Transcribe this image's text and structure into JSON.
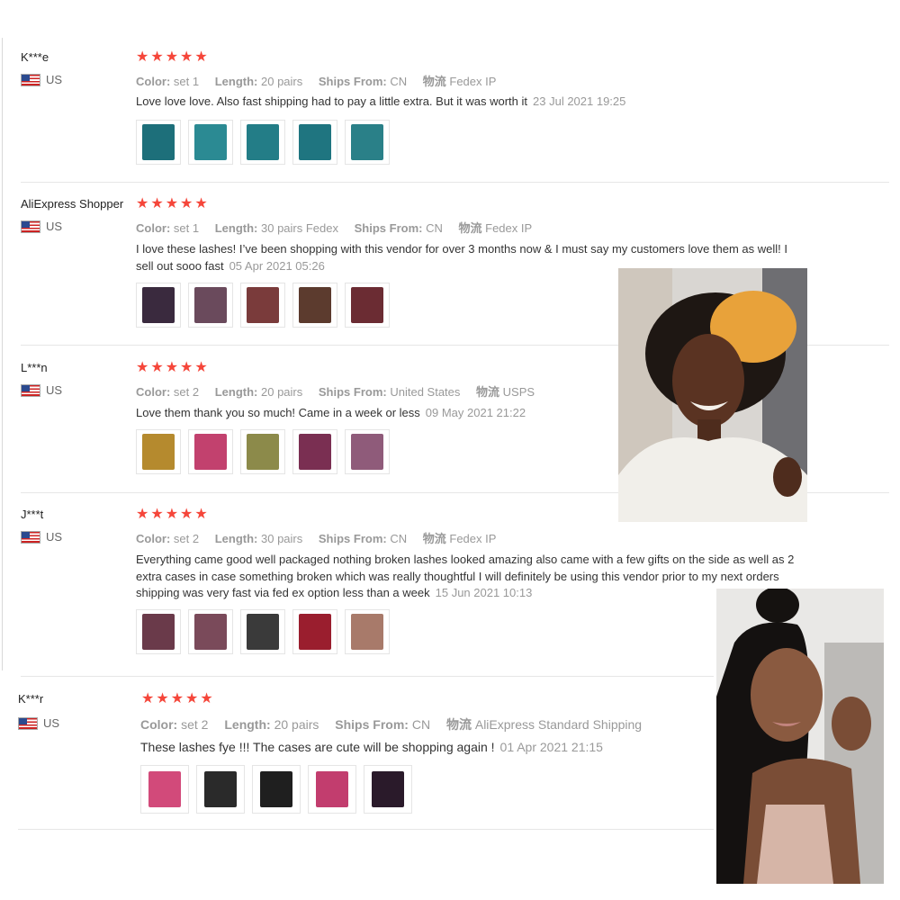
{
  "reviews": [
    {
      "user": "K***e",
      "country": "US",
      "stars": "★★★★★",
      "color_label": "Color:",
      "color_value": "set 1",
      "length_label": "Length:",
      "length_value": "20 pairs",
      "ships_label": "Ships From:",
      "ships_value": "CN",
      "logistics_label": "物流",
      "logistics_value": "Fedex IP",
      "text": "Love love love. Also fast shipping had to pay a little extra. But it was worth it",
      "date": "23 Jul 2021 19:25",
      "thumb_colors": [
        "#1d6f7a",
        "#2b8a93",
        "#237d87",
        "#1f7580",
        "#2a8088"
      ]
    },
    {
      "user": "AliExpress Shopper",
      "country": "US",
      "stars": "★★★★★",
      "color_label": "Color:",
      "color_value": "set 1",
      "length_label": "Length:",
      "length_value": "30 pairs Fedex",
      "ships_label": "Ships From:",
      "ships_value": "CN",
      "logistics_label": "物流",
      "logistics_value": "Fedex IP",
      "text": "I love these lashes! I’ve been shopping with this vendor for over 3 months now & I must say my customers love them as well! I sell out sooo fast",
      "date": "05 Apr 2021 05:26",
      "thumb_colors": [
        "#3a2a3e",
        "#6a4a5c",
        "#7a3b3b",
        "#5c3b2e",
        "#6b2c33"
      ]
    },
    {
      "user": "L***n",
      "country": "US",
      "stars": "★★★★★",
      "color_label": "Color:",
      "color_value": "set 2",
      "length_label": "Length:",
      "length_value": "20 pairs",
      "ships_label": "Ships From:",
      "ships_value": "United States",
      "logistics_label": "物流",
      "logistics_value": "USPS",
      "text": "Love them thank you so much! Came in a week or less",
      "date": "09 May 2021 21:22",
      "thumb_colors": [
        "#b58a2e",
        "#c2416e",
        "#8c8a4a",
        "#7a2f52",
        "#8f5b7a"
      ]
    },
    {
      "user": "J***t",
      "country": "US",
      "stars": "★★★★★",
      "color_label": "Color:",
      "color_value": "set 2",
      "length_label": "Length:",
      "length_value": "30 pairs",
      "ships_label": "Ships From:",
      "ships_value": "CN",
      "logistics_label": "物流",
      "logistics_value": "Fedex IP",
      "text": "Everything came good well packaged nothing broken lashes looked amazing also came with a few gifts on the side as well as 2 extra cases in case something broken which was really thoughtful I will definitely be using this vendor prior to my next orders shipping was very fast via fed ex option less than a week",
      "date": "15 Jun 2021 10:13",
      "thumb_colors": [
        "#6a3a4a",
        "#7a4a5a",
        "#3a3a3a",
        "#9a1e2e",
        "#a87a6a"
      ]
    },
    {
      "user": "K***r",
      "country": "US",
      "stars": "★★★★★",
      "color_label": "Color:",
      "color_value": "set 2",
      "length_label": "Length:",
      "length_value": "20 pairs",
      "ships_label": "Ships From:",
      "ships_value": "CN",
      "logistics_label": "物流",
      "logistics_value": "AliExpress Standard Shipping",
      "text": "These lashes fye !!! The cases are cute will be shopping again !",
      "date": "01 Apr 2021 21:15",
      "thumb_colors": [
        "#d24a7a",
        "#2a2a2a",
        "#1f1f1f",
        "#c23d6e",
        "#2a1a2a"
      ]
    }
  ]
}
